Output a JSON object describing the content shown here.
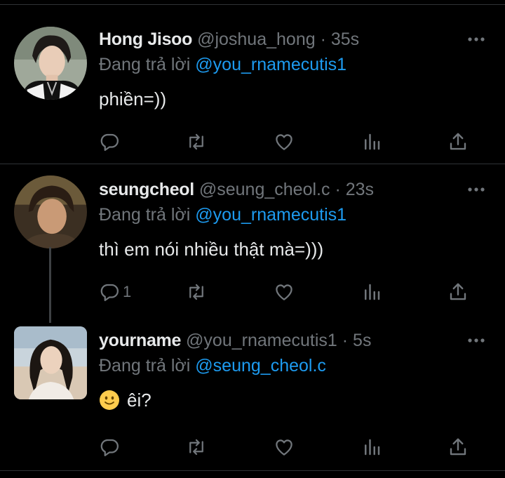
{
  "tweets": [
    {
      "name": "Hong Jisoo",
      "handle": "@joshua_hong",
      "dot": "·",
      "time": "35s",
      "reply_prefix": "Đang trả lời",
      "reply_to": "@you_rnamecutis1",
      "text": "phiền=))",
      "reply_count": ""
    },
    {
      "name": "seungcheol",
      "handle": "@seung_cheol.c",
      "dot": "·",
      "time": "23s",
      "reply_prefix": "Đang trả lời",
      "reply_to": "@you_rnamecutis1",
      "text": "thì em nói nhiều thật mà=)))",
      "reply_count": "1"
    },
    {
      "name": "yourname",
      "handle": "@you_rnamecutis1",
      "dot": "·",
      "time": "5s",
      "reply_prefix": "Đang trả lời",
      "reply_to": "@seung_cheol.c",
      "text": "êi?",
      "reply_count": ""
    }
  ],
  "icons": [
    "more-icon",
    "reply-icon",
    "retweet-icon",
    "like-icon",
    "views-icon",
    "share-icon",
    "smile-emoji-icon"
  ],
  "colors": {
    "background": "#000000",
    "text": "#e7e9ea",
    "muted": "#71767b",
    "mention": "#1d9bf0",
    "divider": "#2f3336"
  }
}
